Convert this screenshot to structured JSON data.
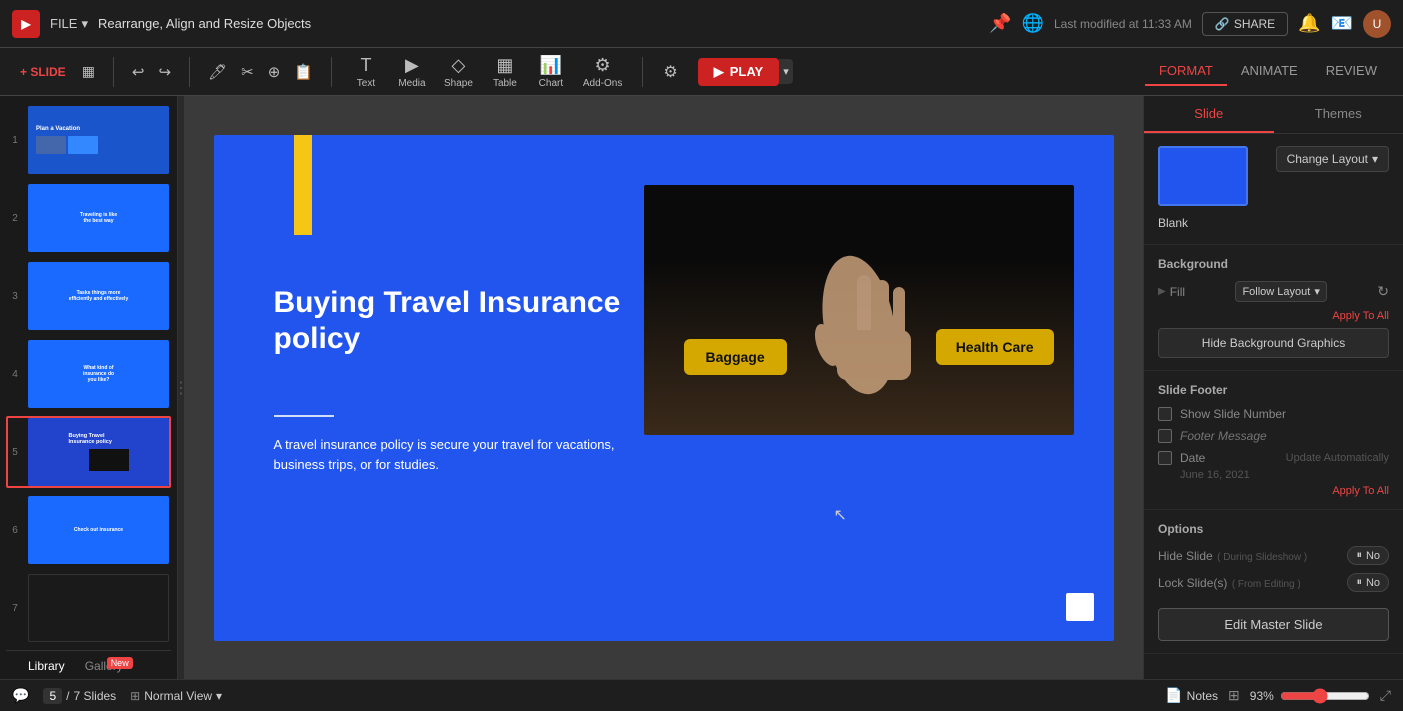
{
  "app": {
    "logo": "▶",
    "file_label": "FILE",
    "doc_title": "Rearrange, Align and Resize Objects",
    "last_modified": "Last modified at 11:33 AM",
    "share_label": "SHARE"
  },
  "toolbar": {
    "slide_label": "+ SLIDE",
    "tools": [
      {
        "name": "text-tool",
        "icon": "T",
        "label": "Text"
      },
      {
        "name": "media-tool",
        "icon": "▶",
        "label": "Media"
      },
      {
        "name": "shape-tool",
        "icon": "◇",
        "label": "Shape"
      },
      {
        "name": "table-tool",
        "icon": "▦",
        "label": "Table"
      },
      {
        "name": "chart-tool",
        "icon": "📊",
        "label": "Chart"
      },
      {
        "name": "addons-tool",
        "icon": "⚙",
        "label": "Add-Ons"
      }
    ],
    "play_label": "PLAY",
    "format_label": "FORMAT",
    "animate_label": "ANIMATE",
    "review_label": "REVIEW"
  },
  "slides": [
    {
      "num": 1,
      "title": "Plan a Vacation"
    },
    {
      "num": 2,
      "title": "Traveling is like"
    },
    {
      "num": 3,
      "title": "Tasks things more"
    },
    {
      "num": 4,
      "title": "What kind of insurance"
    },
    {
      "num": 5,
      "title": "Buying Travel Insurance policy",
      "active": true
    },
    {
      "num": 6,
      "title": "Check out insurance"
    },
    {
      "num": 7,
      "title": ""
    }
  ],
  "slide": {
    "title": "Buying Travel Insurance policy",
    "body": "A travel insurance policy is secure your travel for vacations, business trips, or for studies.",
    "btn_baggage": "Baggage",
    "btn_healthcare": "Health Care"
  },
  "right_panel": {
    "tabs": [
      {
        "label": "Slide",
        "active": true
      },
      {
        "label": "Themes",
        "active": false
      }
    ],
    "layout": {
      "name": "Blank",
      "change_layout_label": "Change Layout"
    },
    "background": {
      "title": "Background",
      "fill_label": "Fill",
      "fill_value": "Follow Layout",
      "apply_all": "Apply To All",
      "hide_bg_label": "Hide Background Graphics"
    },
    "footer": {
      "title": "Slide Footer",
      "show_slide_num_label": "Show Slide Number",
      "footer_message_label": "Footer Message",
      "footer_placeholder": "Footer Message",
      "date_label": "Date",
      "date_auto": "Update Automatically",
      "date_value": "June 16, 2021",
      "apply_all": "Apply To All"
    },
    "options": {
      "title": "Options",
      "hide_slide_label": "Hide Slide",
      "hide_slide_sub": "( During Slideshow )",
      "hide_slide_value": "No",
      "lock_slides_label": "Lock Slide(s)",
      "lock_slides_sub": "( From Editing )",
      "lock_slides_value": "No"
    },
    "edit_master_label": "Edit Master Slide"
  },
  "bottom": {
    "slide_current": "5",
    "slide_total": "7 Slides",
    "normal_view_label": "Normal View",
    "notes_label": "Notes",
    "zoom_value": "93%",
    "library_label": "Library",
    "gallery_label": "Gallery",
    "new_badge": "New"
  }
}
